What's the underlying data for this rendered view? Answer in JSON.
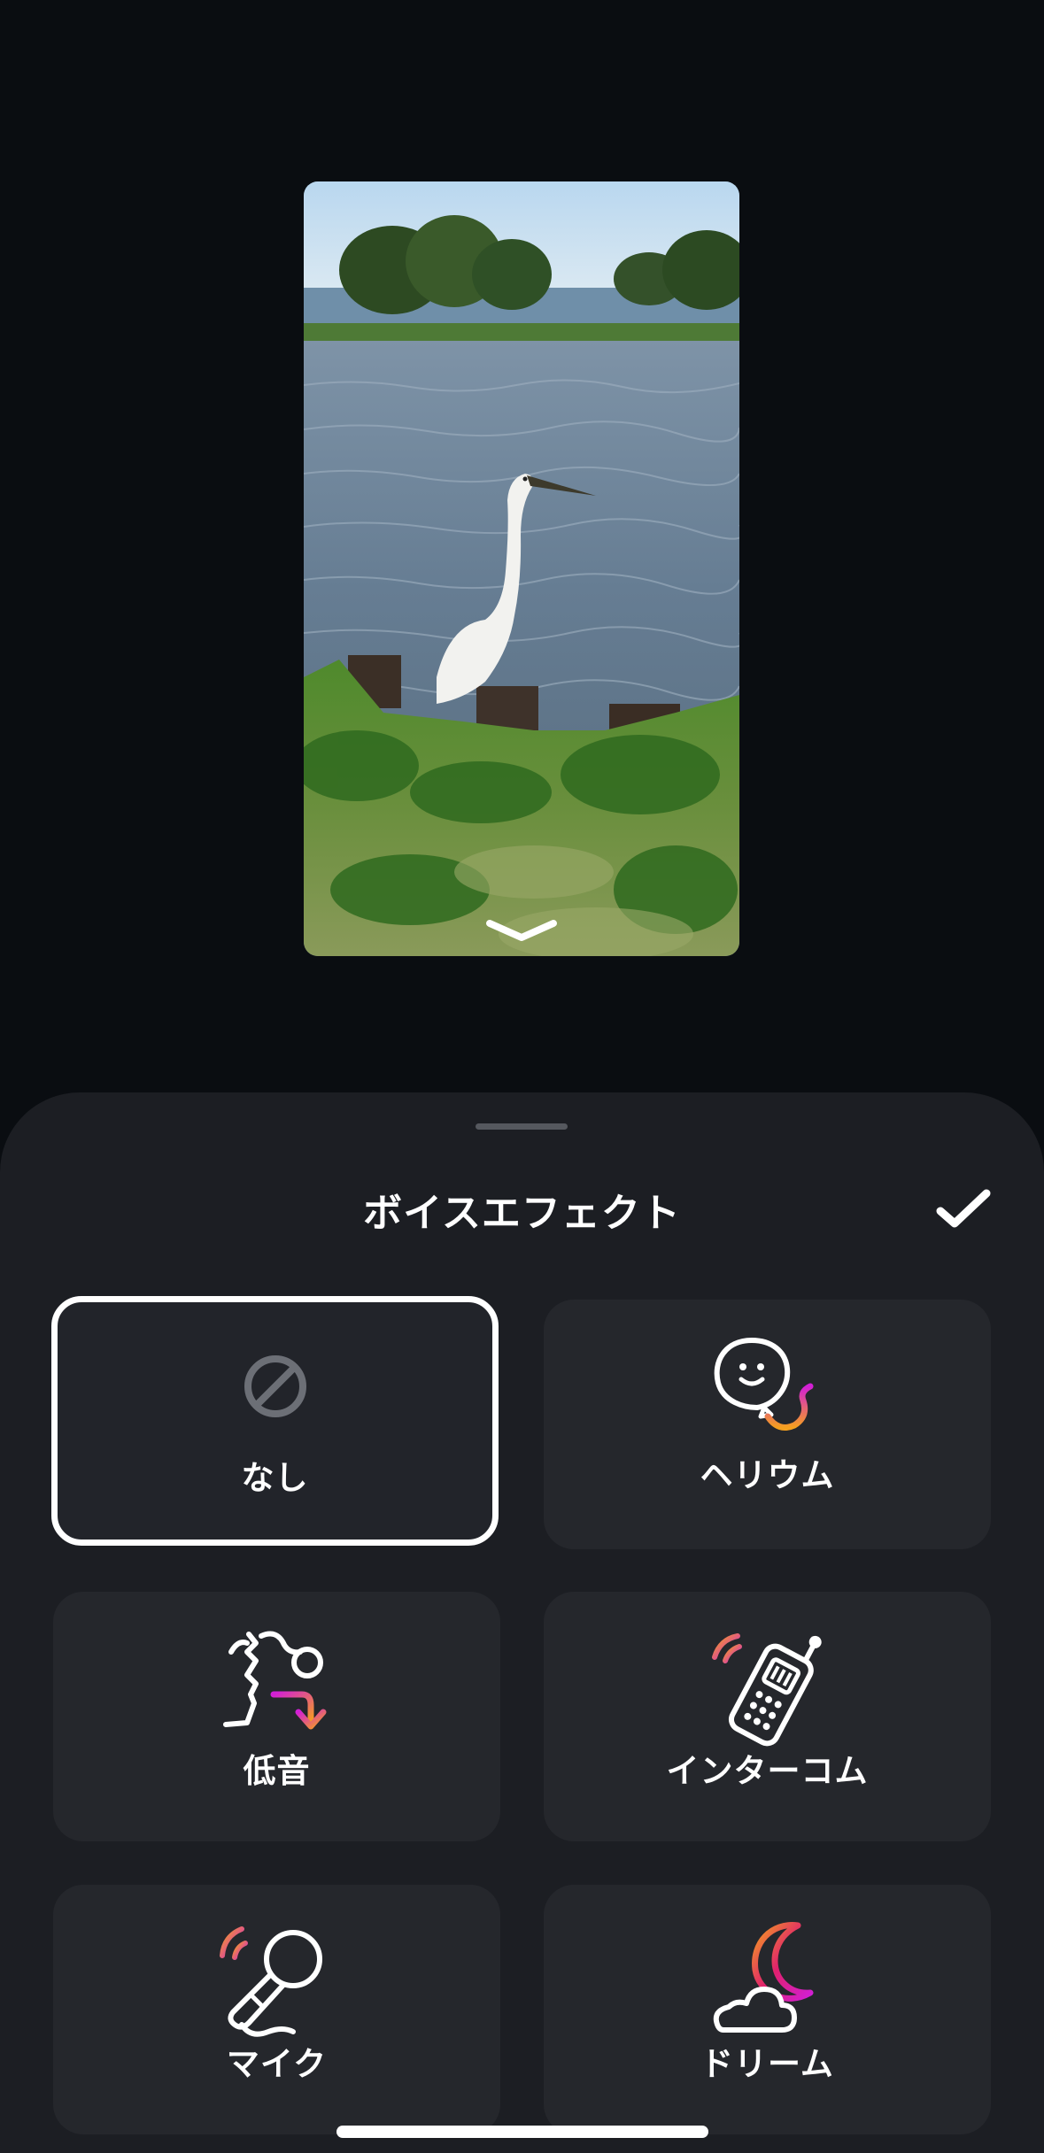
{
  "preview": {
    "collapse_icon": "chevron-down-icon"
  },
  "sheet": {
    "title": "ボイスエフェクト",
    "done_icon": "checkmark-icon"
  },
  "effects": [
    {
      "label": "なし",
      "icon": "none-icon",
      "selected": true
    },
    {
      "label": "ヘリウム",
      "icon": "helium-balloon-icon",
      "selected": false
    },
    {
      "label": "低音",
      "icon": "low-voice-icon",
      "selected": false
    },
    {
      "label": "インターコム",
      "icon": "walkie-talkie-icon",
      "selected": false
    },
    {
      "label": "マイク",
      "icon": "microphone-icon",
      "selected": false
    },
    {
      "label": "ドリーム",
      "icon": "moon-cloud-icon",
      "selected": false
    }
  ],
  "colors": {
    "background": "#0a0d11",
    "sheet": "#1c1e23",
    "tile": "#25272c",
    "accent_magenta": "#d21fd6",
    "accent_orange": "#f5a01e"
  }
}
